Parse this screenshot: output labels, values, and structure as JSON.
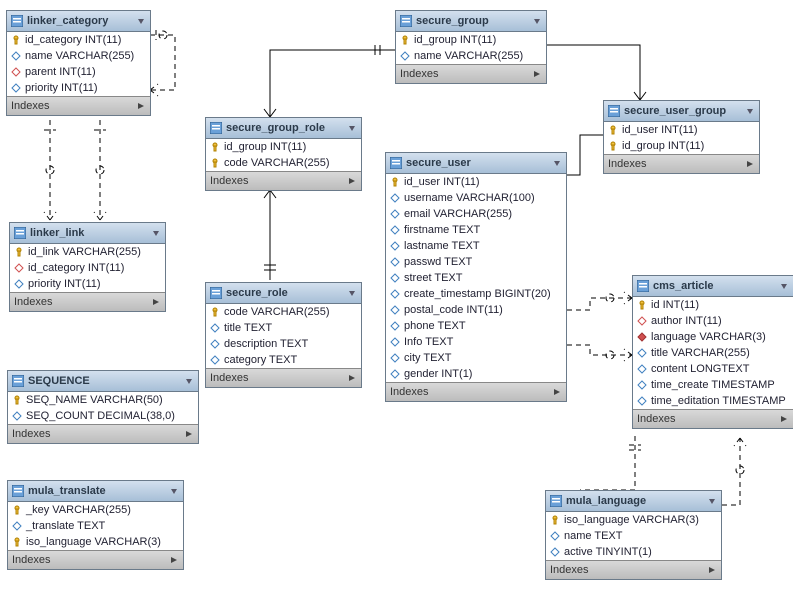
{
  "labels": {
    "indexes": "Indexes"
  },
  "entities": {
    "linker_category": {
      "title": "linker_category",
      "columns": [
        {
          "name": "id_category INT(11)",
          "kind": "pk"
        },
        {
          "name": "name VARCHAR(255)",
          "kind": "col"
        },
        {
          "name": "parent INT(11)",
          "kind": "fk"
        },
        {
          "name": "priority INT(11)",
          "kind": "col"
        }
      ]
    },
    "linker_link": {
      "title": "linker_link",
      "columns": [
        {
          "name": "id_link VARCHAR(255)",
          "kind": "pk"
        },
        {
          "name": "id_category INT(11)",
          "kind": "fk"
        },
        {
          "name": "priority INT(11)",
          "kind": "col"
        }
      ]
    },
    "sequence": {
      "title": "SEQUENCE",
      "columns": [
        {
          "name": "SEQ_NAME VARCHAR(50)",
          "kind": "pk"
        },
        {
          "name": "SEQ_COUNT DECIMAL(38,0)",
          "kind": "col"
        }
      ]
    },
    "mula_translate": {
      "title": "mula_translate",
      "columns": [
        {
          "name": "_key VARCHAR(255)",
          "kind": "pk"
        },
        {
          "name": "_translate TEXT",
          "kind": "col"
        },
        {
          "name": "iso_language VARCHAR(3)",
          "kind": "pk"
        }
      ]
    },
    "secure_group_role": {
      "title": "secure_group_role",
      "columns": [
        {
          "name": "id_group INT(11)",
          "kind": "pk"
        },
        {
          "name": "code VARCHAR(255)",
          "kind": "pk"
        }
      ]
    },
    "secure_role": {
      "title": "secure_role",
      "columns": [
        {
          "name": "code VARCHAR(255)",
          "kind": "pk"
        },
        {
          "name": "title TEXT",
          "kind": "col"
        },
        {
          "name": "description TEXT",
          "kind": "col"
        },
        {
          "name": "category TEXT",
          "kind": "col"
        }
      ]
    },
    "secure_group": {
      "title": "secure_group",
      "columns": [
        {
          "name": "id_group INT(11)",
          "kind": "pk"
        },
        {
          "name": "name VARCHAR(255)",
          "kind": "col"
        }
      ]
    },
    "secure_user": {
      "title": "secure_user",
      "columns": [
        {
          "name": "id_user INT(11)",
          "kind": "pk"
        },
        {
          "name": "username VARCHAR(100)",
          "kind": "col"
        },
        {
          "name": "email VARCHAR(255)",
          "kind": "col"
        },
        {
          "name": "firstname TEXT",
          "kind": "col"
        },
        {
          "name": "lastname TEXT",
          "kind": "col"
        },
        {
          "name": "passwd TEXT",
          "kind": "col"
        },
        {
          "name": "street TEXT",
          "kind": "col"
        },
        {
          "name": "create_timestamp BIGINT(20)",
          "kind": "col"
        },
        {
          "name": "postal_code INT(11)",
          "kind": "col"
        },
        {
          "name": "phone TEXT",
          "kind": "col"
        },
        {
          "name": "Info TEXT",
          "kind": "col"
        },
        {
          "name": "city TEXT",
          "kind": "col"
        },
        {
          "name": "gender INT(1)",
          "kind": "col"
        }
      ]
    },
    "secure_user_group": {
      "title": "secure_user_group",
      "columns": [
        {
          "name": "id_user INT(11)",
          "kind": "pk"
        },
        {
          "name": "id_group INT(11)",
          "kind": "pk"
        }
      ]
    },
    "cms_article": {
      "title": "cms_article",
      "columns": [
        {
          "name": "id INT(11)",
          "kind": "pk"
        },
        {
          "name": "author INT(11)",
          "kind": "fk"
        },
        {
          "name": "language VARCHAR(3)",
          "kind": "fk-req"
        },
        {
          "name": "title VARCHAR(255)",
          "kind": "col"
        },
        {
          "name": "content LONGTEXT",
          "kind": "col"
        },
        {
          "name": "time_create TIMESTAMP",
          "kind": "col"
        },
        {
          "name": "time_editation TIMESTAMP",
          "kind": "col"
        }
      ]
    },
    "mula_language": {
      "title": "mula_language",
      "columns": [
        {
          "name": "iso_language VARCHAR(3)",
          "kind": "pk"
        },
        {
          "name": "name TEXT",
          "kind": "col"
        },
        {
          "name": "active TINYINT(1)",
          "kind": "col"
        }
      ]
    }
  },
  "chart_data": {
    "type": "table",
    "diagram_type": "entity-relationship",
    "tables": [
      {
        "name": "linker_category",
        "columns": [
          "id_category INT(11) PK",
          "name VARCHAR(255)",
          "parent INT(11) FK",
          "priority INT(11)"
        ]
      },
      {
        "name": "linker_link",
        "columns": [
          "id_link VARCHAR(255) PK",
          "id_category INT(11) FK",
          "priority INT(11)"
        ]
      },
      {
        "name": "SEQUENCE",
        "columns": [
          "SEQ_NAME VARCHAR(50) PK",
          "SEQ_COUNT DECIMAL(38,0)"
        ]
      },
      {
        "name": "mula_translate",
        "columns": [
          "_key VARCHAR(255) PK",
          "_translate TEXT",
          "iso_language VARCHAR(3) PK"
        ]
      },
      {
        "name": "secure_group_role",
        "columns": [
          "id_group INT(11) PK",
          "code VARCHAR(255) PK"
        ]
      },
      {
        "name": "secure_role",
        "columns": [
          "code VARCHAR(255) PK",
          "title TEXT",
          "description TEXT",
          "category TEXT"
        ]
      },
      {
        "name": "secure_group",
        "columns": [
          "id_group INT(11) PK",
          "name VARCHAR(255)"
        ]
      },
      {
        "name": "secure_user",
        "columns": [
          "id_user INT(11) PK",
          "username VARCHAR(100)",
          "email VARCHAR(255)",
          "firstname TEXT",
          "lastname TEXT",
          "passwd TEXT",
          "street TEXT",
          "create_timestamp BIGINT(20)",
          "postal_code INT(11)",
          "phone TEXT",
          "Info TEXT",
          "city TEXT",
          "gender INT(1)"
        ]
      },
      {
        "name": "secure_user_group",
        "columns": [
          "id_user INT(11) PK",
          "id_group INT(11) PK"
        ]
      },
      {
        "name": "cms_article",
        "columns": [
          "id INT(11) PK",
          "author INT(11) FK",
          "language VARCHAR(3) FK",
          "title VARCHAR(255)",
          "content LONGTEXT",
          "time_create TIMESTAMP",
          "time_editation TIMESTAMP"
        ]
      },
      {
        "name": "mula_language",
        "columns": [
          "iso_language VARCHAR(3) PK",
          "name TEXT",
          "active TINYINT(1)"
        ]
      }
    ],
    "relationships": [
      {
        "from": "linker_category.parent",
        "to": "linker_category.id_category",
        "type": "self-1:N-optional"
      },
      {
        "from": "linker_link.id_category",
        "to": "linker_category.id_category",
        "type": "1:N-optional"
      },
      {
        "from": "secure_group_role.id_group",
        "to": "secure_group.id_group",
        "type": "1:N"
      },
      {
        "from": "secure_group_role.code",
        "to": "secure_role.code",
        "type": "1:N"
      },
      {
        "from": "secure_user_group.id_group",
        "to": "secure_group.id_group",
        "type": "1:N"
      },
      {
        "from": "secure_user_group.id_user",
        "to": "secure_user.id_user",
        "type": "1:N"
      },
      {
        "from": "cms_article.author",
        "to": "secure_user.id_user",
        "type": "1:N-optional"
      },
      {
        "from": "cms_article.language",
        "to": "mula_language.iso_language",
        "type": "1:N-optional"
      }
    ]
  }
}
